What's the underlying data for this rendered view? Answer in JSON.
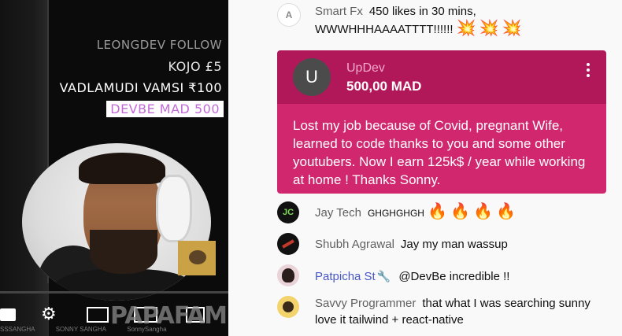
{
  "video": {
    "overlay_lines": [
      "LEONGDEV FOLLOW",
      "KOJO £5",
      "VADLAMUDI VAMSI ₹100",
      "DEVBE MAD 500"
    ],
    "watermark": "PAPAFAM",
    "socials": [
      "SSSANGHA",
      "SONNY SANGHA",
      "SonnySangha"
    ],
    "controls": [
      "subtitles",
      "settings",
      "miniplayer",
      "theater-mode",
      "fullscreen"
    ]
  },
  "chat": {
    "messages": [
      {
        "author": "Smart Fx",
        "text": "450 likes in 30 mins, WWWHHHAAAATTTT!!!!!!",
        "emojis": [
          "💥",
          "💥",
          "💥"
        ],
        "avatar": "A"
      },
      {
        "author": "Jay Tech",
        "text": "GHGHGHGH",
        "emojis": [
          "🔥",
          "🔥",
          "🔥",
          "🔥"
        ],
        "avatar": "JC"
      },
      {
        "author": "Shubh Agrawal",
        "text": "Jay my man wassup",
        "avatar": ""
      },
      {
        "author": "Patpicha St",
        "badge": "🔧",
        "text": "@DevBe incredible !!",
        "avatar": ""
      },
      {
        "author": "Savvy Programmer",
        "text": "that what I was searching sunny love it tailwind + react-native",
        "avatar": ""
      }
    ],
    "superchat": {
      "avatar_letter": "U",
      "author": "UpDev",
      "amount": "500,00 MAD",
      "text": "Lost my job because of Covid, pregnant Wife, learned to code thanks to you and some other youtubers. Now I earn 125k$ / year while working at home ! Thanks Sonny.",
      "header_color": "#b0185a",
      "body_color": "#d1276f"
    }
  }
}
